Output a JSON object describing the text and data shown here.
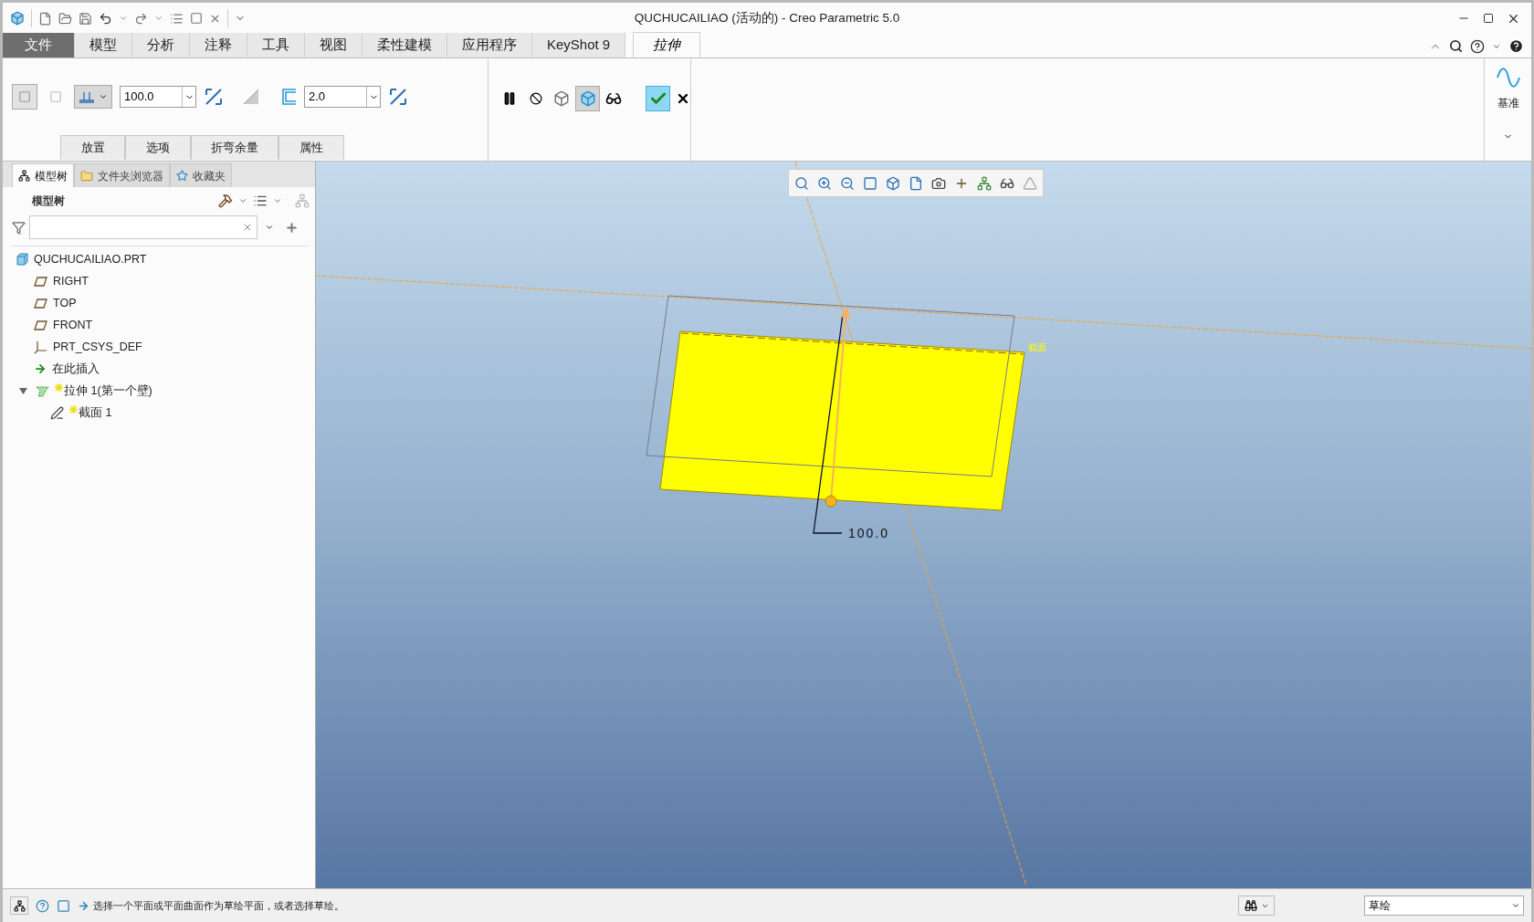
{
  "window": {
    "title": "QUCHUCAILIAO (活动的) - Creo Parametric 5.0"
  },
  "ribbon_tabs": [
    {
      "label": "文件",
      "kind": "file",
      "selected": false
    },
    {
      "label": "模型",
      "kind": "tab",
      "selected": false
    },
    {
      "label": "分析",
      "kind": "tab",
      "selected": false
    },
    {
      "label": "注释",
      "kind": "tab",
      "selected": false
    },
    {
      "label": "工具",
      "kind": "tab",
      "selected": false
    },
    {
      "label": "视图",
      "kind": "tab",
      "selected": false
    },
    {
      "label": "柔性建模",
      "kind": "tab",
      "selected": false
    },
    {
      "label": "应用程序",
      "kind": "tab",
      "selected": false
    },
    {
      "label": "KeyShot 9",
      "kind": "tab",
      "selected": false
    },
    {
      "label": "拉伸",
      "kind": "tab",
      "selected": true
    }
  ],
  "extrude": {
    "depth_value": "100.0",
    "thickness_value": "2.0",
    "subtabs": [
      "放置",
      "选项",
      "折弯余量",
      "属性"
    ],
    "preview_buttons": [
      {
        "kind": "pause",
        "pressed": false
      },
      {
        "kind": "no-preview",
        "pressed": false
      },
      {
        "kind": "wireframe",
        "pressed": false
      },
      {
        "kind": "geometry",
        "pressed": true
      },
      {
        "kind": "verify",
        "pressed": false
      }
    ]
  },
  "datum_group": {
    "label": "基准"
  },
  "left_panel": {
    "tabs": [
      {
        "label": "模型树",
        "kind": "tree",
        "selected": true
      },
      {
        "label": "文件夹浏览器",
        "kind": "folder",
        "selected": false
      },
      {
        "label": "收藏夹",
        "kind": "favorites",
        "selected": false
      }
    ],
    "title": "模型树",
    "tree": [
      {
        "label": "QUCHUCAILIAO.PRT",
        "kind": "part",
        "new": false,
        "children": [
          {
            "label": "RIGHT",
            "kind": "plane",
            "new": false
          },
          {
            "label": "TOP",
            "kind": "plane",
            "new": false
          },
          {
            "label": "FRONT",
            "kind": "plane",
            "new": false
          },
          {
            "label": "PRT_CSYS_DEF",
            "kind": "csys",
            "new": false
          },
          {
            "label": "在此插入",
            "kind": "insert",
            "new": false
          },
          {
            "label": "拉伸 1(第一个壁)",
            "kind": "feature",
            "new": true,
            "expanded": true,
            "children": [
              {
                "label": "截面 1",
                "kind": "sketch",
                "new": true
              }
            ]
          }
        ]
      }
    ]
  },
  "viewport": {
    "dimension": "100.0",
    "section_label": "截面"
  },
  "status_bar": {
    "message": "选择一个平面或平面曲面作为草绘平面，或者选择草绘。",
    "mode": "草绘"
  }
}
